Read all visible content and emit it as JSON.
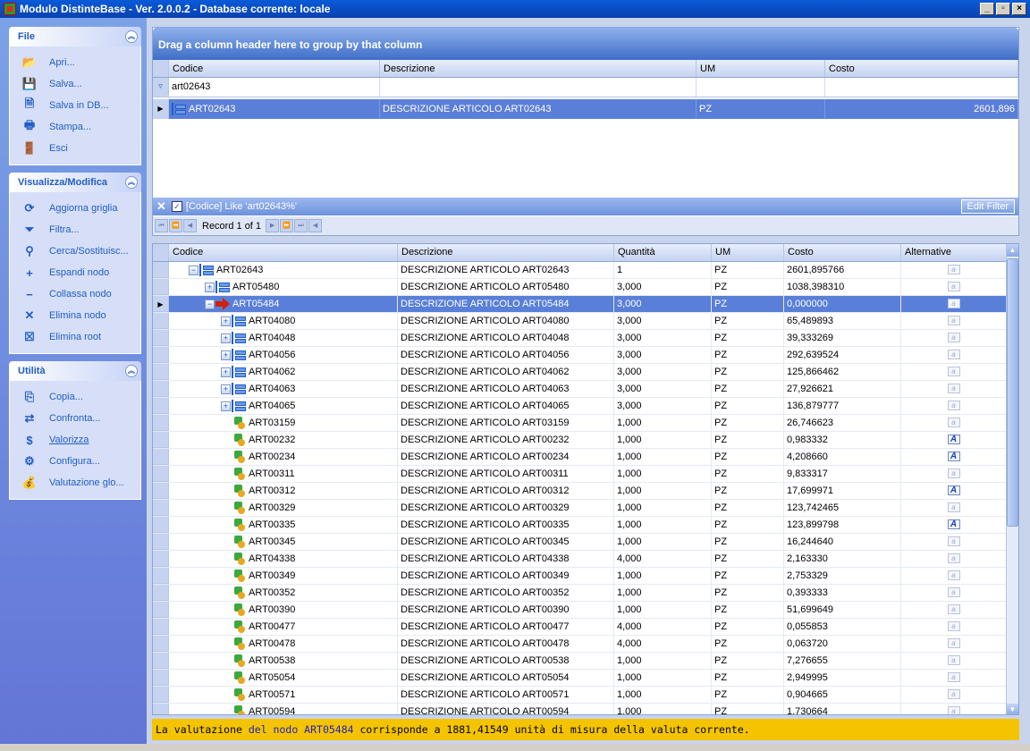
{
  "window": {
    "title": "Modulo DistinteBase - Ver. 2.0.0.2 - Database corrente: locale",
    "min": "_",
    "max": "▫",
    "close": "×"
  },
  "sidebar": {
    "groups": [
      {
        "title": "File",
        "items": [
          {
            "label": "Apri...",
            "icon": "folder-open-icon",
            "glyph": "📂"
          },
          {
            "label": "Salva...",
            "icon": "floppy-disk-icon",
            "glyph": "💾"
          },
          {
            "label": "Salva in DB...",
            "icon": "save-db-icon",
            "glyph": "🗎"
          },
          {
            "label": "Stampa...",
            "icon": "printer-icon",
            "glyph": "🖶"
          },
          {
            "label": "Esci",
            "icon": "exit-door-icon",
            "glyph": "🚪"
          }
        ]
      },
      {
        "title": "Visualizza/Modifica",
        "items": [
          {
            "label": "Aggiorna griglia",
            "icon": "refresh-icon",
            "glyph": "⟳"
          },
          {
            "label": "Filtra...",
            "icon": "funnel-icon",
            "glyph": "⏷"
          },
          {
            "label": "Cerca/Sostituisc...",
            "icon": "binoculars-icon",
            "glyph": "⚲"
          },
          {
            "label": "Espandi nodo",
            "icon": "plus-icon",
            "glyph": "+"
          },
          {
            "label": "Collassa nodo",
            "icon": "minus-icon",
            "glyph": "−"
          },
          {
            "label": "Elimina nodo",
            "icon": "delete-x-icon",
            "glyph": "✕"
          },
          {
            "label": "Elimina root",
            "icon": "delete-root-icon",
            "glyph": "☒"
          }
        ]
      },
      {
        "title": "Utilità",
        "items": [
          {
            "label": "Copia...",
            "icon": "copy-icon",
            "glyph": "⎘"
          },
          {
            "label": "Confronta...",
            "icon": "compare-icon",
            "glyph": "⇄"
          },
          {
            "label": "Valorizza",
            "icon": "money-icon",
            "glyph": "$"
          },
          {
            "label": "Configura...",
            "icon": "configure-icon",
            "glyph": "⚙"
          },
          {
            "label": "Valutazione glo...",
            "icon": "money-bag-icon",
            "glyph": "💰"
          }
        ]
      }
    ]
  },
  "upper_grid": {
    "group_prompt": "Drag a column header here to group by that column",
    "columns": [
      "Codice",
      "Descrizione",
      "UM",
      "Costo"
    ],
    "filter_value": "art02643",
    "row": {
      "codice": "ART02643",
      "descrizione": "DESCRIZIONE ARTICOLO ART02643",
      "um": "PZ",
      "costo": "2601,896"
    },
    "filter_text": "[Codice] Like 'art02643%'",
    "edit_filter": "Edit Filter",
    "record_text": "Record 1 of 1"
  },
  "lower_grid": {
    "columns": [
      "Codice",
      "Descrizione",
      "Quantità",
      "UM",
      "Costo",
      "Alternative"
    ],
    "rows": [
      {
        "level": 0,
        "exp": "−",
        "icon": "bom",
        "codice": "ART02643",
        "descrizione": "DESCRIZIONE ARTICOLO ART02643",
        "quantita": "1",
        "um": "PZ",
        "costo": "2601,895766",
        "alt": false
      },
      {
        "level": 1,
        "exp": "+",
        "icon": "bom",
        "codice": "ART05480",
        "descrizione": "DESCRIZIONE ARTICOLO ART05480",
        "quantita": "3,000",
        "um": "PZ",
        "costo": "1038,398310",
        "alt": false
      },
      {
        "level": 1,
        "exp": "−",
        "icon": "arrow",
        "codice": "ART05484",
        "descrizione": "DESCRIZIONE ARTICOLO ART05484",
        "quantita": "3,000",
        "um": "PZ",
        "costo": "0,000000",
        "alt": false,
        "selected": true
      },
      {
        "level": 2,
        "exp": "+",
        "icon": "bom",
        "codice": "ART04080",
        "descrizione": "DESCRIZIONE ARTICOLO ART04080",
        "quantita": "3,000",
        "um": "PZ",
        "costo": "65,489893",
        "alt": false
      },
      {
        "level": 2,
        "exp": "+",
        "icon": "bom",
        "codice": "ART04048",
        "descrizione": "DESCRIZIONE ARTICOLO ART04048",
        "quantita": "3,000",
        "um": "PZ",
        "costo": "39,333269",
        "alt": false
      },
      {
        "level": 2,
        "exp": "+",
        "icon": "bom",
        "codice": "ART04056",
        "descrizione": "DESCRIZIONE ARTICOLO ART04056",
        "quantita": "3,000",
        "um": "PZ",
        "costo": "292,639524",
        "alt": false
      },
      {
        "level": 2,
        "exp": "+",
        "icon": "bom",
        "codice": "ART04062",
        "descrizione": "DESCRIZIONE ARTICOLO ART04062",
        "quantita": "3,000",
        "um": "PZ",
        "costo": "125,866462",
        "alt": false
      },
      {
        "level": 2,
        "exp": "+",
        "icon": "bom",
        "codice": "ART04063",
        "descrizione": "DESCRIZIONE ARTICOLO ART04063",
        "quantita": "3,000",
        "um": "PZ",
        "costo": "27,926621",
        "alt": false
      },
      {
        "level": 2,
        "exp": "+",
        "icon": "bom",
        "codice": "ART04065",
        "descrizione": "DESCRIZIONE ARTICOLO ART04065",
        "quantita": "3,000",
        "um": "PZ",
        "costo": "136,879777",
        "alt": false
      },
      {
        "level": 2,
        "exp": "",
        "icon": "part",
        "codice": "ART03159",
        "descrizione": "DESCRIZIONE ARTICOLO ART03159",
        "quantita": "1,000",
        "um": "PZ",
        "costo": "26,746623",
        "alt": false
      },
      {
        "level": 2,
        "exp": "",
        "icon": "part",
        "codice": "ART00232",
        "descrizione": "DESCRIZIONE ARTICOLO ART00232",
        "quantita": "1,000",
        "um": "PZ",
        "costo": "0,983332",
        "alt": true
      },
      {
        "level": 2,
        "exp": "",
        "icon": "part",
        "codice": "ART00234",
        "descrizione": "DESCRIZIONE ARTICOLO ART00234",
        "quantita": "1,000",
        "um": "PZ",
        "costo": "4,208660",
        "alt": true
      },
      {
        "level": 2,
        "exp": "",
        "icon": "part",
        "codice": "ART00311",
        "descrizione": "DESCRIZIONE ARTICOLO ART00311",
        "quantita": "1,000",
        "um": "PZ",
        "costo": "9,833317",
        "alt": false
      },
      {
        "level": 2,
        "exp": "",
        "icon": "part",
        "codice": "ART00312",
        "descrizione": "DESCRIZIONE ARTICOLO ART00312",
        "quantita": "1,000",
        "um": "PZ",
        "costo": "17,699971",
        "alt": true
      },
      {
        "level": 2,
        "exp": "",
        "icon": "part",
        "codice": "ART00329",
        "descrizione": "DESCRIZIONE ARTICOLO ART00329",
        "quantita": "1,000",
        "um": "PZ",
        "costo": "123,742465",
        "alt": false
      },
      {
        "level": 2,
        "exp": "",
        "icon": "part",
        "codice": "ART00335",
        "descrizione": "DESCRIZIONE ARTICOLO ART00335",
        "quantita": "1,000",
        "um": "PZ",
        "costo": "123,899798",
        "alt": true
      },
      {
        "level": 2,
        "exp": "",
        "icon": "part",
        "codice": "ART00345",
        "descrizione": "DESCRIZIONE ARTICOLO ART00345",
        "quantita": "1,000",
        "um": "PZ",
        "costo": "16,244640",
        "alt": false
      },
      {
        "level": 2,
        "exp": "",
        "icon": "part",
        "codice": "ART04338",
        "descrizione": "DESCRIZIONE ARTICOLO ART04338",
        "quantita": "4,000",
        "um": "PZ",
        "costo": "2,163330",
        "alt": false
      },
      {
        "level": 2,
        "exp": "",
        "icon": "part",
        "codice": "ART00349",
        "descrizione": "DESCRIZIONE ARTICOLO ART00349",
        "quantita": "1,000",
        "um": "PZ",
        "costo": "2,753329",
        "alt": false
      },
      {
        "level": 2,
        "exp": "",
        "icon": "part",
        "codice": "ART00352",
        "descrizione": "DESCRIZIONE ARTICOLO ART00352",
        "quantita": "1,000",
        "um": "PZ",
        "costo": "0,393333",
        "alt": false
      },
      {
        "level": 2,
        "exp": "",
        "icon": "part",
        "codice": "ART00390",
        "descrizione": "DESCRIZIONE ARTICOLO ART00390",
        "quantita": "1,000",
        "um": "PZ",
        "costo": "51,699649",
        "alt": false
      },
      {
        "level": 2,
        "exp": "",
        "icon": "part",
        "codice": "ART00477",
        "descrizione": "DESCRIZIONE ARTICOLO ART00477",
        "quantita": "4,000",
        "um": "PZ",
        "costo": "0,055853",
        "alt": false
      },
      {
        "level": 2,
        "exp": "",
        "icon": "part",
        "codice": "ART00478",
        "descrizione": "DESCRIZIONE ARTICOLO ART00478",
        "quantita": "4,000",
        "um": "PZ",
        "costo": "0,063720",
        "alt": false
      },
      {
        "level": 2,
        "exp": "",
        "icon": "part",
        "codice": "ART00538",
        "descrizione": "DESCRIZIONE ARTICOLO ART00538",
        "quantita": "1,000",
        "um": "PZ",
        "costo": "7,276655",
        "alt": false
      },
      {
        "level": 2,
        "exp": "",
        "icon": "part",
        "codice": "ART05054",
        "descrizione": "DESCRIZIONE ARTICOLO ART05054",
        "quantita": "1,000",
        "um": "PZ",
        "costo": "2,949995",
        "alt": false
      },
      {
        "level": 2,
        "exp": "",
        "icon": "part",
        "codice": "ART00571",
        "descrizione": "DESCRIZIONE ARTICOLO ART00571",
        "quantita": "1,000",
        "um": "PZ",
        "costo": "0,904665",
        "alt": false
      },
      {
        "level": 2,
        "exp": "",
        "icon": "part",
        "codice": "ART00594",
        "descrizione": "DESCRIZIONE ARTICOLO ART00594",
        "quantita": "1,000",
        "um": "PZ",
        "costo": "1,730664",
        "alt": false
      }
    ]
  },
  "status": {
    "part1": "La valutazione ",
    "part2": "del nodo ART05484",
    "part3": " corrisponde a 1881,41549 unità di misura della valuta corrente."
  },
  "colors": {
    "accent": "#215dc6",
    "selection": "#5a7fd8",
    "status_bg": "#f5c400"
  }
}
